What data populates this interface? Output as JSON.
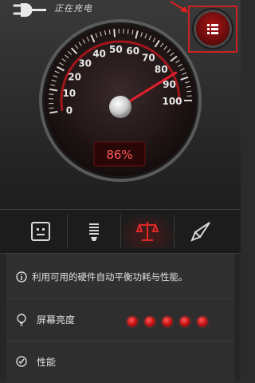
{
  "status": {
    "charging_text": "正在充电",
    "plug_icon": "plug-icon"
  },
  "menu_button": {
    "icon": "menu-list-icon",
    "highlight_color": "#d02020"
  },
  "gauge": {
    "tick_labels": [
      "0",
      "10",
      "20",
      "30",
      "40",
      "50",
      "60",
      "70",
      "80",
      "90",
      "100"
    ],
    "value": 86,
    "readout": "86%",
    "accent_color": "#e0202a"
  },
  "modes": [
    {
      "name": "mode-custom",
      "icon": "face-icon",
      "active": false
    },
    {
      "name": "mode-long-standby",
      "icon": "bulb-icon",
      "active": false
    },
    {
      "name": "mode-balanced",
      "icon": "scale-icon",
      "active": true
    },
    {
      "name": "mode-performance",
      "icon": "rocket-icon",
      "active": false
    }
  ],
  "description": {
    "icon": "info-icon",
    "text": "利用可用的硬件自动平衡功耗与性能。"
  },
  "settings": [
    {
      "icon": "bulb-outline-icon",
      "label": "屏幕亮度",
      "level": 5,
      "max": 5
    },
    {
      "icon": "check-circle-icon",
      "label": "性能"
    }
  ]
}
